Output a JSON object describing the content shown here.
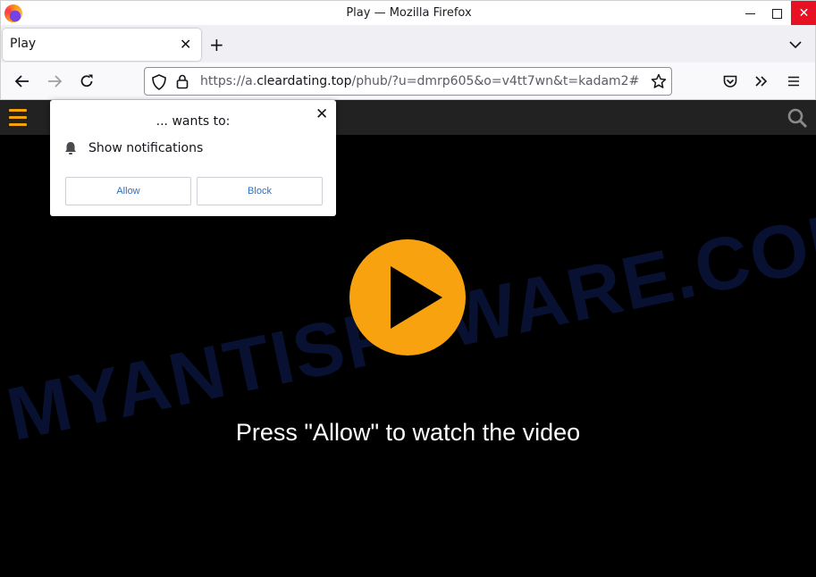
{
  "window": {
    "title": "Play — Mozilla Firefox"
  },
  "tabs": [
    {
      "label": "Play",
      "active": true
    }
  ],
  "controls": {
    "close_tab": "✕",
    "new_tab": "+",
    "tab_list": "⌄",
    "win_close": "✕"
  },
  "urlbar": {
    "url_prefix": "https://a.",
    "url_domain": "cleardating.top",
    "url_suffix": "/phub/?u=dmrp605&o=v4tt7wn&t=kadam2#"
  },
  "page": {
    "message": "Press \"Allow\" to watch the video",
    "watermark": "MYANTISPYWARE.COM",
    "accent_color": "#f9a20f"
  },
  "permission_popup": {
    "title": "... wants to:",
    "permission": "Show notifications",
    "close": "✕",
    "allow_label": "Allow",
    "block_label": "Block"
  }
}
